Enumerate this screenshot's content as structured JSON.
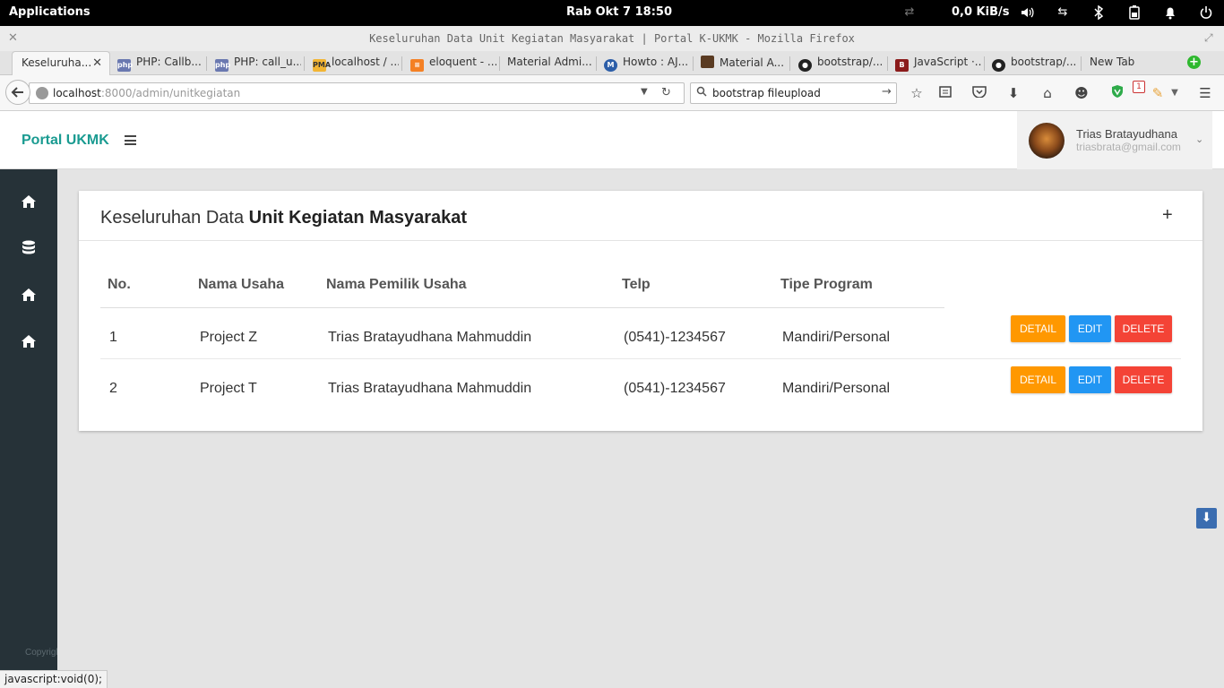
{
  "os": {
    "apps_label": "Applications",
    "clock": "Rab Okt  7    18:50",
    "net_speed": "0,0 KiB/s"
  },
  "window": {
    "title": "Keseluruhan Data Unit Kegiatan Masyarakat | Portal K-UKMK - Mozilla Firefox"
  },
  "tabs": [
    {
      "label": "Keseluruha...",
      "active": true
    },
    {
      "label": "PHP: Callb...",
      "icon": "php"
    },
    {
      "label": "PHP: call_u...",
      "icon": "php"
    },
    {
      "label": "localhost / ...",
      "icon": "pma"
    },
    {
      "label": "eloquent - ...",
      "icon": "stackoverflow"
    },
    {
      "label": "Material Admi..."
    },
    {
      "label": "Howto : AJ...",
      "icon": "M"
    },
    {
      "label": "Material A..."
    },
    {
      "label": "bootstrap/...",
      "icon": "github"
    },
    {
      "label": "JavaScript ·...",
      "icon": "B"
    },
    {
      "label": "bootstrap/...",
      "icon": "github"
    },
    {
      "label": "New Tab"
    }
  ],
  "nav": {
    "url_host": "localhost",
    "url_rest": ":8000/admin/unitkegiatan",
    "search_value": "bootstrap fileupload",
    "badge_count": "1"
  },
  "app": {
    "brand": "Portal UKMK",
    "user_name": "Trias Bratayudhana",
    "user_email": "triasbrata@gmail.com",
    "copyright": "Copyright"
  },
  "card": {
    "title_prefix": "Keseluruhan Data",
    "title_bold": "Unit Kegiatan Masyarakat",
    "add_label": "+",
    "columns": [
      "No.",
      "Nama Usaha",
      "Nama Pemilik Usaha",
      "Telp",
      "Tipe Program"
    ],
    "rows": [
      {
        "no": "1",
        "nama_usaha": "Project Z",
        "pemilik": "Trias Bratayudhana Mahmuddin",
        "telp": "(0541)-1234567",
        "tipe": "Mandiri/Personal"
      },
      {
        "no": "2",
        "nama_usaha": "Project T",
        "pemilik": "Trias Bratayudhana Mahmuddin",
        "telp": "(0541)-1234567",
        "tipe": "Mandiri/Personal"
      }
    ],
    "actions": {
      "detail": "DETAIL",
      "edit": "EDIT",
      "delete": "DELETE"
    }
  },
  "status_bar": "javascript:void(0);",
  "colors": {
    "brand": "#1a9b91",
    "sidebar": "#263238",
    "detail": "#ff9800",
    "edit": "#2196f3",
    "delete": "#f44336"
  }
}
